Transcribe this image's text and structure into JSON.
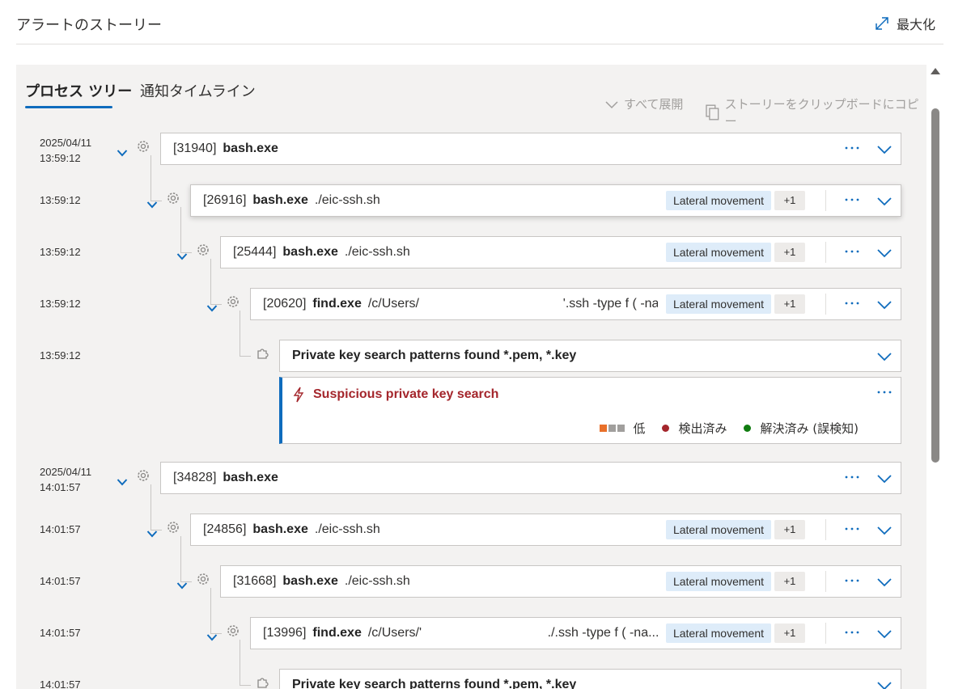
{
  "header": {
    "title": "アラートのストーリー",
    "maximize_label": "最大化"
  },
  "tabs": [
    {
      "label": "プロセス ツリー",
      "active": true
    },
    {
      "label": "通知タイムライン",
      "active": false
    }
  ],
  "actions": {
    "expand_all": "すべて展開",
    "copy_story": "ストーリーをクリップボードにコピー"
  },
  "groups": [
    {
      "date": "2025/04/11",
      "root_time": "13:59:12",
      "processes": [
        {
          "time": "13:59:12",
          "pid": "[31940]",
          "exe": "bash.exe",
          "args": "",
          "tag": "",
          "extra": ""
        },
        {
          "time": "13:59:12",
          "pid": "[26916]",
          "exe": "bash.exe",
          "args": "./eic-ssh.sh",
          "tag": "Lateral movement",
          "extra": "+1"
        },
        {
          "time": "13:59:12",
          "pid": "[25444]",
          "exe": "bash.exe",
          "args": "./eic-ssh.sh",
          "tag": "Lateral movement",
          "extra": "+1"
        },
        {
          "time": "13:59:12",
          "pid": "[20620]",
          "exe": "find.exe",
          "args": "/c/Users/                                        '.ssh -type f ( -na...",
          "tag": "Lateral movement",
          "extra": "+1"
        }
      ],
      "event": {
        "time": "13:59:12",
        "text": "Private key search patterns found *.pem, *.key"
      },
      "alert": {
        "title": "Suspicious private key search",
        "severity": "低",
        "status": "検出済み",
        "resolution": "解決済み (誤検知)",
        "severity_color": "#e8702a",
        "status_color": "#a4262c",
        "resolution_color": "#107c10"
      }
    },
    {
      "date": "2025/04/11",
      "root_time": "14:01:57",
      "processes": [
        {
          "time": "14:01:57",
          "pid": "[34828]",
          "exe": "bash.exe",
          "args": "",
          "tag": "",
          "extra": ""
        },
        {
          "time": "14:01:57",
          "pid": "[24856]",
          "exe": "bash.exe",
          "args": "./eic-ssh.sh",
          "tag": "Lateral movement",
          "extra": "+1"
        },
        {
          "time": "14:01:57",
          "pid": "[31668]",
          "exe": "bash.exe",
          "args": "./eic-ssh.sh",
          "tag": "Lateral movement",
          "extra": "+1"
        },
        {
          "time": "14:01:57",
          "pid": "[13996]",
          "exe": "find.exe",
          "args": "/c/Users/'                                   ./.ssh -type f ( -na...",
          "tag": "Lateral movement",
          "extra": "+1"
        }
      ],
      "event": {
        "time": "14:01:57",
        "text": "Private key search patterns found *.pem, *.key"
      }
    }
  ]
}
